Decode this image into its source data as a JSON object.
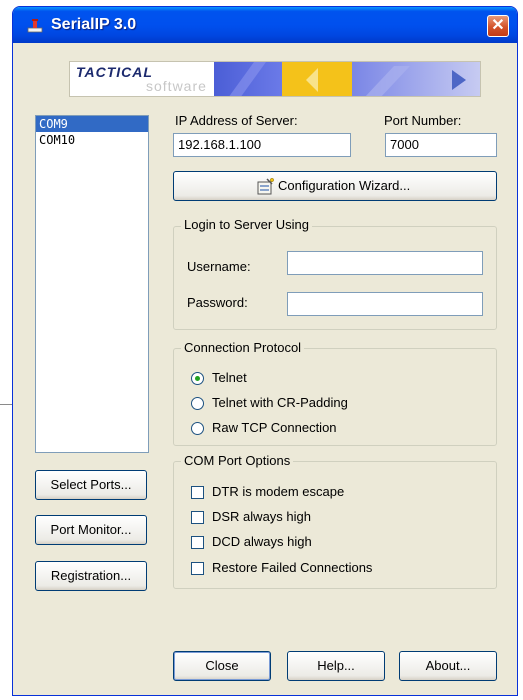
{
  "window": {
    "title": "SerialIP 3.0",
    "close_symbol": "✕"
  },
  "logo": {
    "line1": "TACTICAL",
    "line2": "software"
  },
  "ports": {
    "items": [
      "COM9",
      "COM10"
    ],
    "selected": "COM9"
  },
  "server": {
    "ip_label": "IP Address of Server:",
    "ip_value": "192.168.1.100",
    "port_label": "Port Number:",
    "port_value": "7000"
  },
  "wizard_button": "Configuration Wizard...",
  "login": {
    "legend": "Login to Server Using",
    "username_label": "Username:",
    "username_value": "",
    "password_label": "Password:",
    "password_value": ""
  },
  "protocol": {
    "legend": "Connection Protocol",
    "options": [
      "Telnet",
      "Telnet with CR-Padding",
      "Raw TCP Connection"
    ],
    "selected": "Telnet"
  },
  "com_options": {
    "legend": "COM Port Options",
    "items": [
      {
        "label": "DTR is modem escape",
        "checked": false
      },
      {
        "label": "DSR always high",
        "checked": false
      },
      {
        "label": "DCD always high",
        "checked": false
      },
      {
        "label": "Restore Failed Connections",
        "checked": false
      }
    ]
  },
  "side_buttons": {
    "select_ports": "Select Ports...",
    "port_monitor": "Port Monitor...",
    "registration": "Registration..."
  },
  "footer_buttons": {
    "close": "Close",
    "help": "Help...",
    "about": "About..."
  },
  "colors": {
    "titlebar": "#0054e3",
    "selection": "#316ac5",
    "dialog_bg": "#ece9d8",
    "close_button": "#d3532b"
  }
}
